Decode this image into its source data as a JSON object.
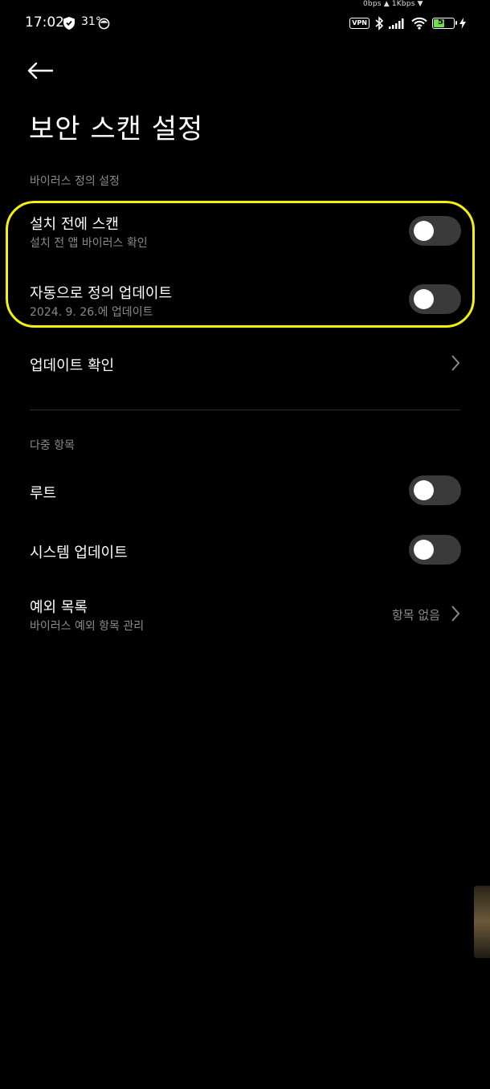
{
  "status_bar": {
    "net_speed": "0bps ▲  1Kbps ▼",
    "time": "17:02",
    "temperature": "31°",
    "vpn": "VPN",
    "battery_level": "58",
    "battery_percent": 58
  },
  "header": {
    "title": "보안 스캔 설정"
  },
  "virus_section": {
    "header": "바이러스 정의 설정",
    "scan_before_install": {
      "title": "설치 전에 스캔",
      "subtitle": "설치 전 앱 바이러스 확인",
      "enabled": false
    },
    "auto_update": {
      "title": "자동으로 정의 업데이트",
      "subtitle": "2024. 9. 26.에 업데이트",
      "enabled": false
    },
    "check_update": {
      "title": "업데이트 확인"
    }
  },
  "multi_section": {
    "header": "다중 항목",
    "root": {
      "title": "루트",
      "enabled": false
    },
    "system_update": {
      "title": "시스템 업데이트",
      "enabled": false
    },
    "exceptions": {
      "title": "예외 목록",
      "subtitle": "바이러스 예외 항목 관리",
      "value": "항목 없음"
    }
  },
  "colors": {
    "background": "#000000",
    "highlight": "#f2f20a",
    "toggle_off": "#3a3a3a",
    "secondary_text": "#8a8a8a",
    "battery": "#6ee04a"
  }
}
